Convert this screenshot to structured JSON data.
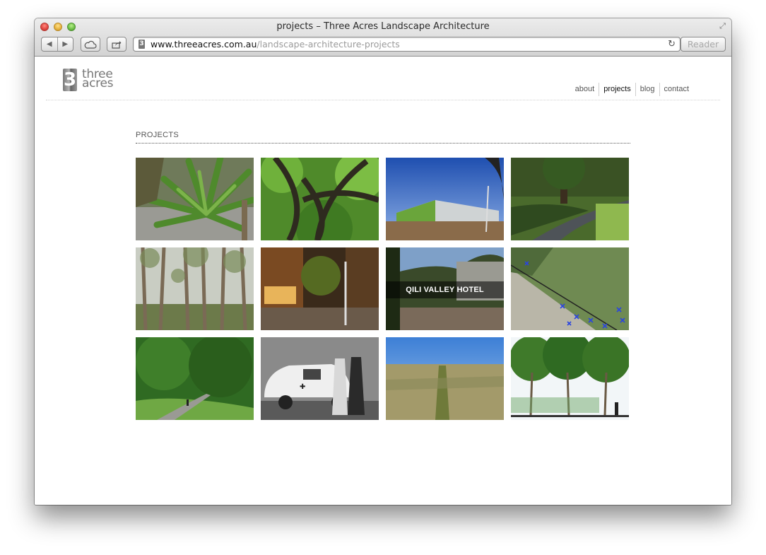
{
  "window": {
    "title": "projects – Three Acres Landscape Architecture",
    "url_domain": "www.threeacres.com.au",
    "url_path": "/landscape-architecture-projects",
    "reader_label": "Reader"
  },
  "site": {
    "logo_line1": "three",
    "logo_line2": "acres",
    "nav": [
      {
        "label": "about"
      },
      {
        "label": "projects"
      },
      {
        "label": "blog"
      },
      {
        "label": "contact"
      }
    ]
  },
  "main": {
    "section_title": "PROJECTS",
    "hovered_caption": "QILI VALLEY HOTEL"
  }
}
